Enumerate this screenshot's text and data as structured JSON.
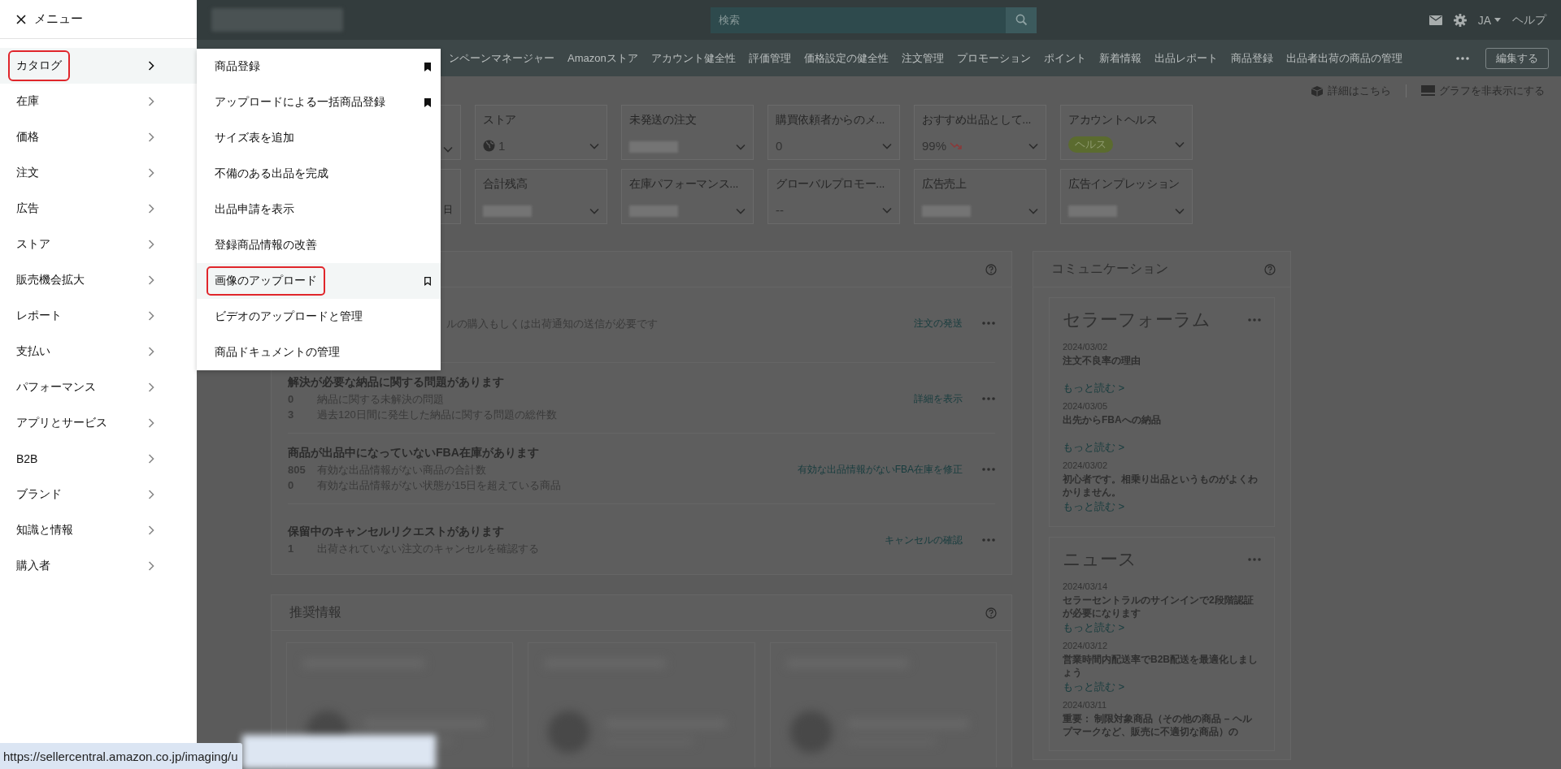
{
  "top_bar": {
    "search": {
      "placeholder": "検索"
    },
    "language": "JA",
    "help": "ヘルプ"
  },
  "nav_bar": {
    "items": [
      "ンペーンマネージャー",
      "Amazonストア",
      "アカウント健全性",
      "評価管理",
      "価格設定の健全性",
      "注文管理",
      "プロモーション",
      "ポイント",
      "新着情報",
      "出品レポート",
      "商品登録",
      "出品者出荷の商品の管理"
    ],
    "edit_button": "編集する"
  },
  "header_links": [
    "詳細はこちら",
    "グラフを非表示にする"
  ],
  "metric_rows": [
    {
      "cards": [
        {
          "kind": "partial"
        },
        {
          "kind": "globe",
          "title": "ストア",
          "value": "1"
        },
        {
          "kind": "blurred",
          "title": "未発送の注文"
        },
        {
          "kind": "text",
          "title": "購買依頼者からのメ...",
          "value": "0"
        },
        {
          "kind": "trend",
          "title": "おすすめ出品として...",
          "value": "99%"
        },
        {
          "kind": "badge",
          "title": "アカウントヘルス",
          "value": "ヘルス"
        }
      ]
    },
    {
      "cards": [
        {
          "kind": "partial",
          "value": "日"
        },
        {
          "kind": "blurred",
          "title": "合計残高"
        },
        {
          "kind": "blurred",
          "title": "在庫パフォーマンス..."
        },
        {
          "kind": "text",
          "title": "グローバルプロモー...",
          "value": "--"
        },
        {
          "kind": "blurred",
          "title": "広告売上"
        },
        {
          "kind": "blurred",
          "title": "広告インプレッション"
        }
      ]
    }
  ],
  "action_panel": {
    "rows": [
      {
        "lines": [
          {
            "text": "ルの購入もしくは出荷通知の送信が必要です"
          }
        ],
        "link": "注文の発送"
      },
      {
        "title": "解決が必要な納品に関する問題があります",
        "lines": [
          {
            "count": "0",
            "text": "納品に関する未解決の問題"
          },
          {
            "count": "3",
            "text": "過去120日間に発生した納品に関する問題の総件数"
          }
        ],
        "link": "詳細を表示"
      },
      {
        "title": "商品が出品中になっていないFBA在庫があります",
        "lines": [
          {
            "count": "805",
            "text": "有効な出品情報がない商品の合計数"
          },
          {
            "count": "0",
            "text": "有効な出品情報がない状態が15日を超えている商品"
          }
        ],
        "link": "有効な出品情報がないFBA在庫を修正"
      },
      {
        "title": "保留中のキャンセルリクエストがあります",
        "lines": [
          {
            "count": "1",
            "text": "出荷されていない注文のキャンセルを確認する"
          }
        ],
        "link": "キャンセルの確認"
      }
    ]
  },
  "recommendations_panel": {
    "title": "推奨情報"
  },
  "communication_panel": {
    "title": "コミュニケーション",
    "sections": [
      {
        "title": "セラーフォーラム",
        "items": [
          {
            "date": "2024/03/02",
            "title": "注文不良率の理由",
            "link": "もっと読む >"
          },
          {
            "date": "2024/03/05",
            "title": "出先からFBAへの納品",
            "link": "もっと読む >"
          },
          {
            "date": "2024/03/02",
            "title": "初心者です。相乗り出品というものがよくわかりません。",
            "link": "もっと読む >"
          }
        ]
      },
      {
        "title": "ニュース",
        "items": [
          {
            "date": "2024/03/14",
            "title": "セラーセントラルのサインインで2段階認証が必要になります",
            "link": "もっと読む >"
          },
          {
            "date": "2024/03/12",
            "title": "営業時間内配送率でB2B配送を最適化しましょう",
            "link": "もっと読む >"
          },
          {
            "date": "2024/03/11",
            "title": "重要： 制限対象商品（その他の商品 – ヘルプマークなど、販売に不適切な商品）の"
          }
        ]
      }
    ]
  },
  "menu": {
    "title": "メニュー",
    "items": [
      {
        "label": "カタログ",
        "selected": true,
        "marked": true
      },
      {
        "label": "在庫",
        "selected": false,
        "marked": false
      },
      {
        "label": "価格",
        "selected": false,
        "marked": false
      },
      {
        "label": "注文",
        "selected": false,
        "marked": false
      },
      {
        "label": "広告",
        "selected": false,
        "marked": false
      },
      {
        "label": "ストア",
        "selected": false,
        "marked": false
      },
      {
        "label": "販売機会拡大",
        "selected": false,
        "marked": false
      },
      {
        "label": "レポート",
        "selected": false,
        "marked": false
      },
      {
        "label": "支払い",
        "selected": false,
        "marked": false
      },
      {
        "label": "パフォーマンス",
        "selected": false,
        "marked": false
      },
      {
        "label": "アプリとサービス",
        "selected": false,
        "marked": false
      },
      {
        "label": "B2B",
        "selected": false,
        "marked": false
      },
      {
        "label": "ブランド",
        "selected": false,
        "marked": false
      },
      {
        "label": "知識と情報",
        "selected": false,
        "marked": false
      },
      {
        "label": "購入者",
        "selected": false,
        "marked": false
      }
    ]
  },
  "submenu": {
    "items": [
      {
        "label": "商品登録",
        "hovered": false,
        "marked": false,
        "bookmarked": true
      },
      {
        "label": "アップロードによる一括商品登録",
        "hovered": false,
        "marked": false,
        "bookmarked": true
      },
      {
        "label": "サイズ表を追加",
        "hovered": false,
        "marked": false,
        "bookmarked": false
      },
      {
        "label": "不備のある出品を完成",
        "hovered": false,
        "marked": false,
        "bookmarked": false
      },
      {
        "label": "出品申請を表示",
        "hovered": false,
        "marked": false,
        "bookmarked": false
      },
      {
        "label": "登録商品情報の改善",
        "hovered": false,
        "marked": false,
        "bookmarked": false
      },
      {
        "label": "画像のアップロード",
        "hovered": true,
        "marked": true,
        "bookmarked": false
      },
      {
        "label": "ビデオのアップロードと管理",
        "hovered": false,
        "marked": false,
        "bookmarked": false
      },
      {
        "label": "商品ドキュメントの管理",
        "hovered": false,
        "marked": false,
        "bookmarked": false
      }
    ]
  },
  "status_bar": {
    "url": "https://sellercentral.amazon.co.jp/imaging/u"
  }
}
